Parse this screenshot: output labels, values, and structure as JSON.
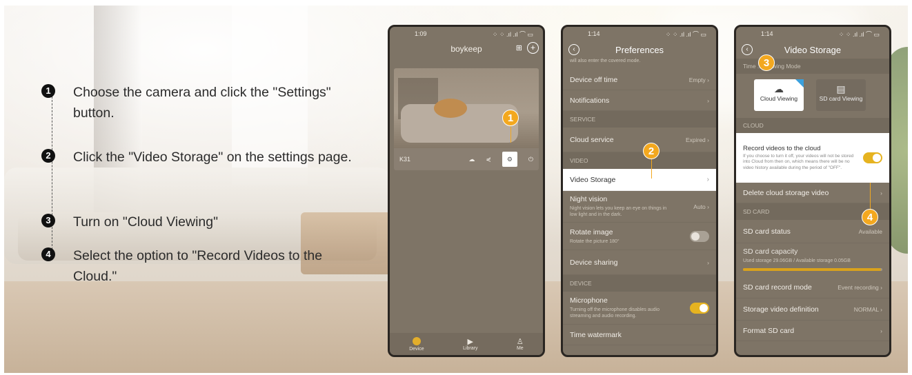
{
  "steps": [
    {
      "num": "1",
      "text": "Choose the camera and click the \"Settings\" button."
    },
    {
      "num": "2",
      "text": "Click the \"Video Storage\" on the settings page."
    },
    {
      "num": "3",
      "text": "Turn on \"Cloud Viewing\""
    },
    {
      "num": "4",
      "text": "Select the option to \"Record Videos to the Cloud.\""
    }
  ],
  "phone1": {
    "time": "1:09",
    "status_right": "⁘ ⁘ .ıl .ıl ⌒ ▭",
    "brand": "boykeep",
    "camera_name": "K31",
    "nav": {
      "device": "Device",
      "library": "Library",
      "me": "Me"
    },
    "annotation": "1"
  },
  "phone2": {
    "time": "1:14",
    "title": "Preferences",
    "top_note": "will also enter the covered mode.",
    "rows": {
      "device_off_time": "Device off time",
      "device_off_value": "Empty",
      "notifications": "Notifications",
      "service_section": "SERVICE",
      "cloud_service": "Cloud service",
      "cloud_service_value": "Expired",
      "video_section": "VIDEO",
      "video_storage": "Video Storage",
      "night_vision": "Night vision",
      "night_vision_sub": "Night vision lets you keep an eye on things in low light and in the dark.",
      "night_vision_value": "Auto",
      "rotate_image": "Rotate image",
      "rotate_image_sub": "Rotate the picture 180°",
      "device_sharing": "Device sharing",
      "device_section": "DEVICE",
      "microphone": "Microphone",
      "microphone_sub": "Turning off the microphone disables audio streaming and audio recording.",
      "time_watermark": "Time watermark"
    },
    "annotation": "2"
  },
  "phone3": {
    "time": "1:14",
    "title": "Video Storage",
    "mode_section": "Time ... Viewing Mode",
    "cloud_viewing": "Cloud Viewing",
    "sd_viewing": "SD card Viewing",
    "cloud_section": "CLOUD",
    "record_title": "Record videos to the cloud",
    "record_desc": "If you choose to turn it off, your videos will not be stored into Cloud from then on, which means there will be no video history available during the period of \"OFF\".",
    "delete_cloud": "Delete cloud storage video",
    "sd_section": "SD CARD",
    "sd_status": "SD card status",
    "sd_status_value": "Available",
    "sd_capacity": "SD card capacity",
    "sd_capacity_sub": "Used storage 29.06GB / Available storage 0.05GB",
    "sd_capacity_used_fraction": 0.99,
    "sd_record_mode": "SD card record mode",
    "sd_record_mode_value": "Event recording",
    "storage_definition": "Storage video definition",
    "storage_definition_value": "NORMAL",
    "format_sd": "Format SD card",
    "annotation_3": "3",
    "annotation_4": "4"
  },
  "colors": {
    "accent": "#f3a81f",
    "toggle_on": "#e6b320",
    "phone_bg": "#7e7466"
  }
}
